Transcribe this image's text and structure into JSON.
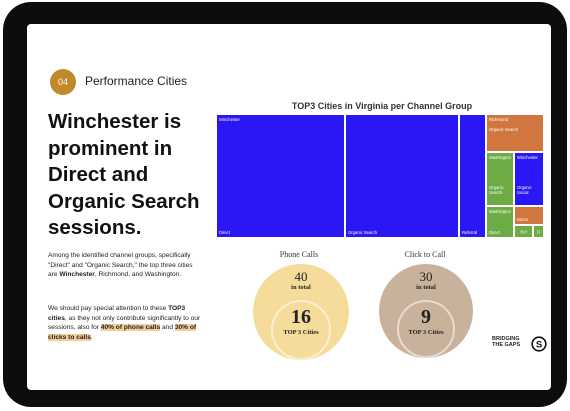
{
  "section": {
    "number": "04",
    "title": "Performance Cities"
  },
  "headline": "Winchester is prominent in Direct and Organic Search sessions.",
  "paragraph1": {
    "text1": "Among the identified channel groups, specifically \"Direct\" and \"Organic Search,\" the top three cities are ",
    "bold1": "Winchester",
    "text2": ", Richmond, and Washington."
  },
  "paragraph2": {
    "text1": "We should pay special attention to these ",
    "bold1": "TOP3 cities",
    "text2": ", as they not only contribute significantly to our sessions, also for ",
    "hl1": "40% of phone calls",
    "text3": " and ",
    "hl2": "30% of clicks to calls",
    "text4": "."
  },
  "treemap": {
    "title": "TOP3 Cities in Virginia per Channel Group",
    "tiles": [
      {
        "top_label": "Winchester",
        "bottom_label": "Direct"
      },
      {
        "bottom_label": "Organic Search"
      },
      {
        "bottom_label": "Referral"
      },
      {
        "top_label": "Richmond",
        "mid_label": "Organic Search"
      },
      {
        "top_label": "Washington",
        "mid_label": "Organic Search"
      },
      {
        "top_label": "Winchester",
        "mid_label": "Organic Social"
      },
      {
        "top_label": "Washington",
        "bottom_label": "Direct"
      },
      {
        "bottom_label": "Direct"
      },
      {
        "center_label": "Ref"
      },
      {
        "center_label": "O"
      }
    ],
    "colors": {
      "blue": "#2a17f5",
      "green": "#6dab44",
      "orange": "#d2763f"
    }
  },
  "phone_calls": {
    "title": "Phone Calls",
    "total": "40",
    "total_label": "in total",
    "top": "16",
    "top_label": "TOP 3 Cities",
    "color": "#f5dc9a"
  },
  "click_to_call": {
    "title": "Click to Call",
    "total": "30",
    "total_label": "in total",
    "top": "9",
    "top_label": "TOP 3 Cities",
    "color": "#c8b29c"
  },
  "logos": {
    "brand": "BRIDGING THE GAPS",
    "icon": "s-circle-logo"
  }
}
